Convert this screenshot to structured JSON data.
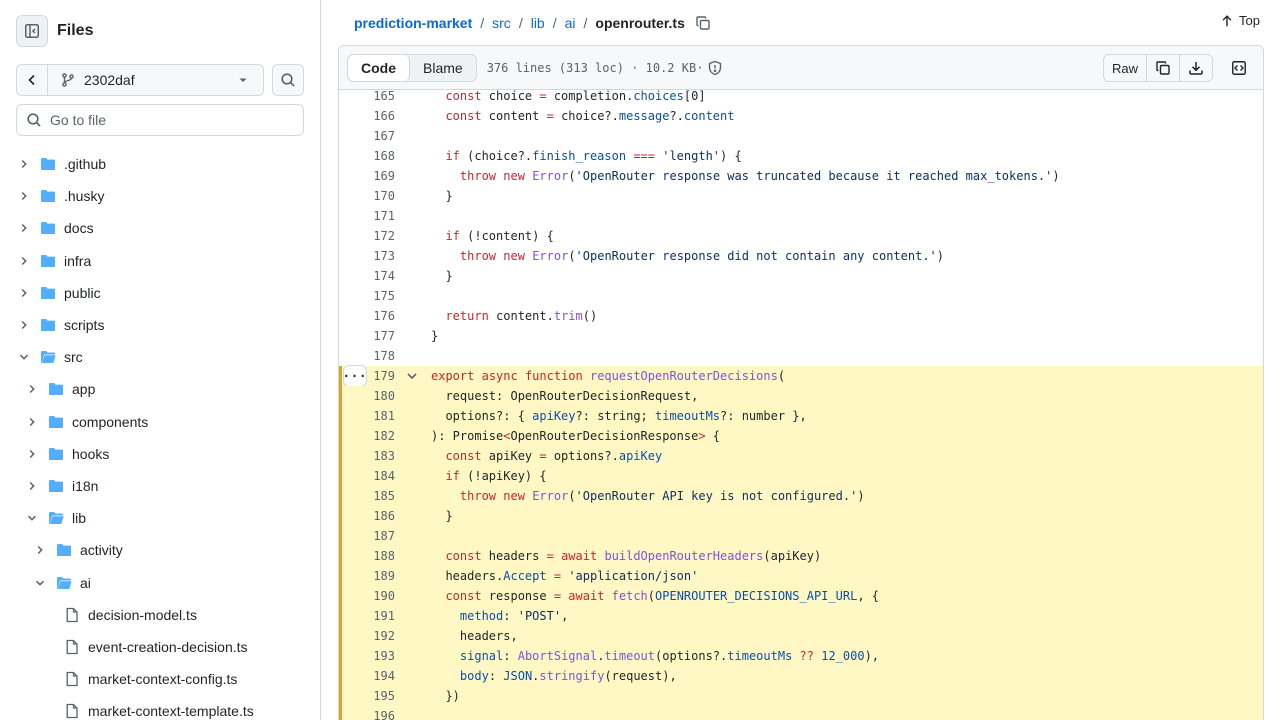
{
  "sidebar": {
    "title": "Files",
    "branch": "2302daf",
    "goto_placeholder": "Go to file",
    "tree": [
      {
        "label": ".github",
        "type": "folder",
        "depth": 0,
        "expanded": false
      },
      {
        "label": ".husky",
        "type": "folder",
        "depth": 0,
        "expanded": false
      },
      {
        "label": "docs",
        "type": "folder",
        "depth": 0,
        "expanded": false
      },
      {
        "label": "infra",
        "type": "folder",
        "depth": 0,
        "expanded": false
      },
      {
        "label": "public",
        "type": "folder",
        "depth": 0,
        "expanded": false
      },
      {
        "label": "scripts",
        "type": "folder",
        "depth": 0,
        "expanded": false
      },
      {
        "label": "src",
        "type": "folder",
        "depth": 0,
        "expanded": true
      },
      {
        "label": "app",
        "type": "folder",
        "depth": 1,
        "expanded": false
      },
      {
        "label": "components",
        "type": "folder",
        "depth": 1,
        "expanded": false
      },
      {
        "label": "hooks",
        "type": "folder",
        "depth": 1,
        "expanded": false
      },
      {
        "label": "i18n",
        "type": "folder",
        "depth": 1,
        "expanded": false
      },
      {
        "label": "lib",
        "type": "folder",
        "depth": 1,
        "expanded": true
      },
      {
        "label": "activity",
        "type": "folder",
        "depth": 2,
        "expanded": false
      },
      {
        "label": "ai",
        "type": "folder",
        "depth": 2,
        "expanded": true
      },
      {
        "label": "decision-model.ts",
        "type": "file",
        "depth": 3
      },
      {
        "label": "event-creation-decision.ts",
        "type": "file",
        "depth": 3
      },
      {
        "label": "market-context-config.ts",
        "type": "file",
        "depth": 3
      },
      {
        "label": "market-context-template.ts",
        "type": "file",
        "depth": 3
      }
    ]
  },
  "breadcrumb": {
    "repo": "prediction-market",
    "parts": [
      "src",
      "lib",
      "ai"
    ],
    "file": "openrouter.ts",
    "separator": "/"
  },
  "top_label": "Top",
  "file_header": {
    "tabs": [
      "Code",
      "Blame"
    ],
    "active_tab": "Code",
    "stats": "376 lines (313 loc) · 10.2 KB·",
    "raw_label": "Raw"
  },
  "colors": {
    "accent": "#0969da",
    "highlight_bg": "#fff8c5",
    "highlight_bar": "#d4a72c",
    "folder": "#54aeff"
  },
  "code": {
    "highlight_start": 179,
    "lines": [
      {
        "n": "165",
        "t": [
          [
            "  ",
            ""
          ],
          [
            "const",
            "kw"
          ],
          [
            " choice ",
            ""
          ],
          [
            "=",
            "kw"
          ],
          [
            " completion.",
            ""
          ],
          [
            "choices",
            "pr"
          ],
          [
            "[0]",
            ""
          ]
        ]
      },
      {
        "n": "166",
        "t": [
          [
            "  ",
            ""
          ],
          [
            "const",
            "kw"
          ],
          [
            " content ",
            ""
          ],
          [
            "=",
            "kw"
          ],
          [
            " choice?.",
            ""
          ],
          [
            "message",
            "pr"
          ],
          [
            "?.",
            ""
          ],
          [
            "content",
            "pr"
          ]
        ]
      },
      {
        "n": "167",
        "t": []
      },
      {
        "n": "168",
        "t": [
          [
            "  ",
            ""
          ],
          [
            "if",
            "kw"
          ],
          [
            " (choice?.",
            ""
          ],
          [
            "finish_reason",
            "pr"
          ],
          [
            " ",
            ""
          ],
          [
            "===",
            "kw"
          ],
          [
            " ",
            ""
          ],
          [
            "'length'",
            "st"
          ],
          [
            ") {",
            ""
          ]
        ]
      },
      {
        "n": "169",
        "t": [
          [
            "    ",
            ""
          ],
          [
            "throw",
            "kw"
          ],
          [
            " ",
            ""
          ],
          [
            "new",
            "kw"
          ],
          [
            " ",
            ""
          ],
          [
            "Error",
            "fn"
          ],
          [
            "(",
            ""
          ],
          [
            "'OpenRouter response was truncated because it reached max_tokens.'",
            "st"
          ],
          [
            ")",
            ""
          ]
        ]
      },
      {
        "n": "170",
        "t": [
          [
            "  }",
            ""
          ]
        ]
      },
      {
        "n": "171",
        "t": []
      },
      {
        "n": "172",
        "t": [
          [
            "  ",
            ""
          ],
          [
            "if",
            "kw"
          ],
          [
            " (!content) {",
            ""
          ]
        ]
      },
      {
        "n": "173",
        "t": [
          [
            "    ",
            ""
          ],
          [
            "throw",
            "kw"
          ],
          [
            " ",
            ""
          ],
          [
            "new",
            "kw"
          ],
          [
            " ",
            ""
          ],
          [
            "Error",
            "fn"
          ],
          [
            "(",
            ""
          ],
          [
            "'OpenRouter response did not contain any content.'",
            "st"
          ],
          [
            ")",
            ""
          ]
        ]
      },
      {
        "n": "174",
        "t": [
          [
            "  }",
            ""
          ]
        ]
      },
      {
        "n": "175",
        "t": []
      },
      {
        "n": "176",
        "t": [
          [
            "  ",
            ""
          ],
          [
            "return",
            "kw"
          ],
          [
            " content.",
            ""
          ],
          [
            "trim",
            "fn"
          ],
          [
            "()",
            ""
          ]
        ]
      },
      {
        "n": "177",
        "t": [
          [
            "}",
            ""
          ]
        ]
      },
      {
        "n": "178",
        "t": []
      },
      {
        "n": "179",
        "t": [
          [
            "export",
            "kw"
          ],
          [
            " ",
            ""
          ],
          [
            "async",
            "kw"
          ],
          [
            " ",
            ""
          ],
          [
            "function",
            "kw"
          ],
          [
            " ",
            ""
          ],
          [
            "requestOpenRouterDecisions",
            "fn"
          ],
          [
            "(",
            ""
          ]
        ]
      },
      {
        "n": "180",
        "t": [
          [
            "  request: OpenRouterDecisionRequest,",
            ""
          ]
        ]
      },
      {
        "n": "181",
        "t": [
          [
            "  options?: { ",
            ""
          ],
          [
            "apiKey",
            "pr"
          ],
          [
            "?: string; ",
            ""
          ],
          [
            "timeoutMs",
            "pr"
          ],
          [
            "?: number },",
            ""
          ]
        ]
      },
      {
        "n": "182",
        "t": [
          [
            "): Promise",
            ""
          ],
          [
            "<",
            "kw"
          ],
          [
            "OpenRouterDecisionResponse",
            ""
          ],
          [
            ">",
            "kw"
          ],
          [
            " {",
            ""
          ]
        ]
      },
      {
        "n": "183",
        "t": [
          [
            "  ",
            ""
          ],
          [
            "const",
            "kw"
          ],
          [
            " apiKey ",
            ""
          ],
          [
            "=",
            "kw"
          ],
          [
            " options?.",
            ""
          ],
          [
            "apiKey",
            "pr"
          ]
        ]
      },
      {
        "n": "184",
        "t": [
          [
            "  ",
            ""
          ],
          [
            "if",
            "kw"
          ],
          [
            " (!apiKey) {",
            ""
          ]
        ]
      },
      {
        "n": "185",
        "t": [
          [
            "    ",
            ""
          ],
          [
            "throw",
            "kw"
          ],
          [
            " ",
            ""
          ],
          [
            "new",
            "kw"
          ],
          [
            " ",
            ""
          ],
          [
            "Error",
            "fn"
          ],
          [
            "(",
            ""
          ],
          [
            "'OpenRouter API key is not configured.'",
            "st"
          ],
          [
            ")",
            ""
          ]
        ]
      },
      {
        "n": "186",
        "t": [
          [
            "  }",
            ""
          ]
        ]
      },
      {
        "n": "187",
        "t": []
      },
      {
        "n": "188",
        "t": [
          [
            "  ",
            ""
          ],
          [
            "const",
            "kw"
          ],
          [
            " headers ",
            ""
          ],
          [
            "=",
            "kw"
          ],
          [
            " ",
            ""
          ],
          [
            "await",
            "kw"
          ],
          [
            " ",
            ""
          ],
          [
            "buildOpenRouterHeaders",
            "fn"
          ],
          [
            "(apiKey)",
            ""
          ]
        ]
      },
      {
        "n": "189",
        "t": [
          [
            "  headers.",
            ""
          ],
          [
            "Accept",
            "pr"
          ],
          [
            " ",
            ""
          ],
          [
            "=",
            "kw"
          ],
          [
            " ",
            ""
          ],
          [
            "'application/json'",
            "st"
          ]
        ]
      },
      {
        "n": "190",
        "t": [
          [
            "  ",
            ""
          ],
          [
            "const",
            "kw"
          ],
          [
            " response ",
            ""
          ],
          [
            "=",
            "kw"
          ],
          [
            " ",
            ""
          ],
          [
            "await",
            "kw"
          ],
          [
            " ",
            ""
          ],
          [
            "fetch",
            "fn"
          ],
          [
            "(",
            ""
          ],
          [
            "OPENROUTER_DECISIONS_API_URL",
            "pr"
          ],
          [
            ", {",
            ""
          ]
        ]
      },
      {
        "n": "191",
        "t": [
          [
            "    ",
            ""
          ],
          [
            "method",
            "pr"
          ],
          [
            ": ",
            ""
          ],
          [
            "'POST'",
            "st"
          ],
          [
            ",",
            ""
          ]
        ]
      },
      {
        "n": "192",
        "t": [
          [
            "    headers,",
            ""
          ]
        ]
      },
      {
        "n": "193",
        "t": [
          [
            "    ",
            ""
          ],
          [
            "signal",
            "pr"
          ],
          [
            ": ",
            ""
          ],
          [
            "AbortSignal",
            "fn"
          ],
          [
            ".",
            ""
          ],
          [
            "timeout",
            "fn"
          ],
          [
            "(options?.",
            ""
          ],
          [
            "timeoutMs",
            "pr"
          ],
          [
            " ",
            ""
          ],
          [
            "??",
            "kw"
          ],
          [
            " ",
            ""
          ],
          [
            "12_000",
            "pr"
          ],
          [
            "),",
            ""
          ]
        ]
      },
      {
        "n": "194",
        "t": [
          [
            "    ",
            ""
          ],
          [
            "body",
            "pr"
          ],
          [
            ": ",
            ""
          ],
          [
            "JSON",
            "pr"
          ],
          [
            ".",
            ""
          ],
          [
            "stringify",
            "fn"
          ],
          [
            "(request),",
            ""
          ]
        ]
      },
      {
        "n": "195",
        "t": [
          [
            "  })",
            ""
          ]
        ]
      },
      {
        "n": "196",
        "t": []
      }
    ]
  }
}
